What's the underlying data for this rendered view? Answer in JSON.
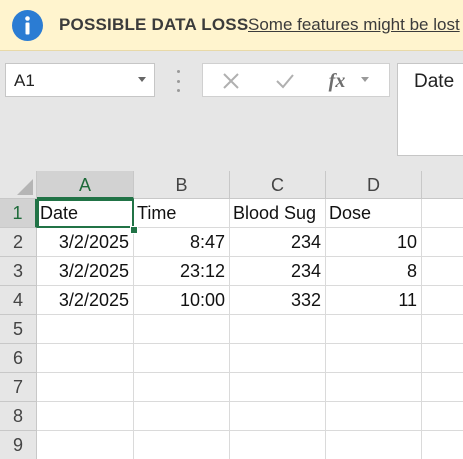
{
  "message_bar": {
    "title": "POSSIBLE DATA LOSS",
    "text": "Some features might be lost"
  },
  "formula_bar": {
    "name_box": "A1",
    "fx_label": "fx",
    "formula_content": "Date",
    "icons": [
      "cancel-icon",
      "enter-check-icon",
      "insert-function-icon"
    ]
  },
  "sheet": {
    "columns": [
      "A",
      "B",
      "C",
      "D"
    ],
    "row_numbers": [
      "1",
      "2",
      "3",
      "4",
      "5",
      "6",
      "7",
      "8",
      "9"
    ],
    "selected_cell": "A1",
    "header_row": [
      "Date",
      "Time",
      "Blood Sug",
      "Dose"
    ],
    "rows": [
      [
        "3/2/2025",
        "8:47",
        "234",
        "10"
      ],
      [
        "3/2/2025",
        "23:12",
        "234",
        "8"
      ],
      [
        "3/2/2025",
        "10:00",
        "332",
        "11"
      ]
    ]
  },
  "colors": {
    "message_bar_bg": "#fff4ce",
    "info_icon": "#2b7cd3",
    "selection_accent": "#217346"
  }
}
